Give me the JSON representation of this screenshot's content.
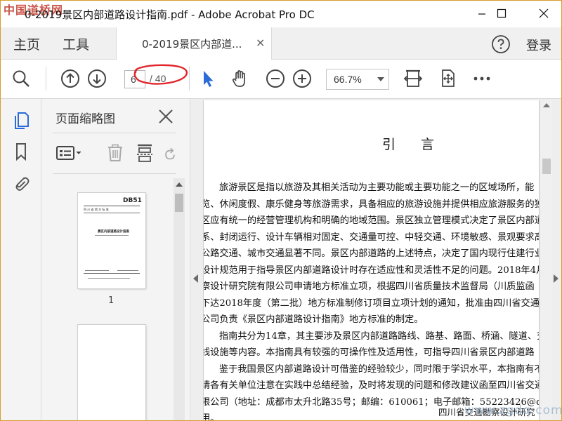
{
  "window": {
    "title": "0-2019景区内部道路设计指南.pdf - Adobe Acrobat Pro DC",
    "watermark": "中国道桥网"
  },
  "tabbar": {
    "home_label": "主页",
    "tools_label": "工具",
    "doc_tab_label": "0-2019景区内部道...",
    "doc_tab_close": "×",
    "login_label": "登录"
  },
  "toolbar": {
    "page_current": "6",
    "page_total": "/ 40",
    "zoom_value": "66.7%"
  },
  "thumbnails": {
    "title": "页面缩略图",
    "page1_number": "1",
    "page1_code": "DB51",
    "page1_heading_line": "四 川 省 地 方 标 准",
    "page1_title": "景区内部道路设计指南"
  },
  "document": {
    "heading": "引言",
    "lines": [
      "旅游景区是指以旅游及其相关活动为主要功能或主要功能之一的区域场所，能",
      "览、休闲度假、康乐健身等旅游需求，具备相应的旅游设施并提供相应旅游服务的独",
      "区应有统一的经营管理机构和明确的地域范围。景区独立管理模式决定了景区内部道",
      "系、封闭运行、设计车辆相对固定、交通量可控、中轻交通、环境敏感、景观要求高",
      "公路交通、城市交通显著不同。景区内部道路的上述特点，决定了国内现行住建行业",
      "设计规范用于指导景区内部道路设计时存在适应性和灵活性不足的问题。2018年4月",
      "察设计研究院有限公司申请地方标准立项，根据四川省质量技术监督局（川质监函",
      "下达2018年度（第二批）地方标准制修订项目立项计划的通知，批准由四川省交通勘",
      "公司负责《景区内部道路设计指南》地方标准的制定。",
      "指南共分为14章，其主要涉及景区内部道路路线、路基、路面、桥涵、隧道、交",
      "线设施等内容。本指南具有较强的可操作性及适用性，可指导四川省景区内部道路",
      "鉴于我国景区内部道路设计可借鉴的经验较少，同时限于学识水平，本指南有不",
      "请各有关单位注意在实践中总结经验，及时将发现的问题和修改建议函至四川省交通",
      "限公司（地址：成都市太升北路35号；邮编：610061；电子邮箱：55223426@qq.com",
      "用。"
    ],
    "footer": "四川省交通勘察设计研究",
    "footer_watermark": "www.zgdq.com"
  },
  "colors": {
    "accent_blue": "#2c6bd8",
    "annotation_red": "#e0252b",
    "window_border": "#d69c2f"
  }
}
